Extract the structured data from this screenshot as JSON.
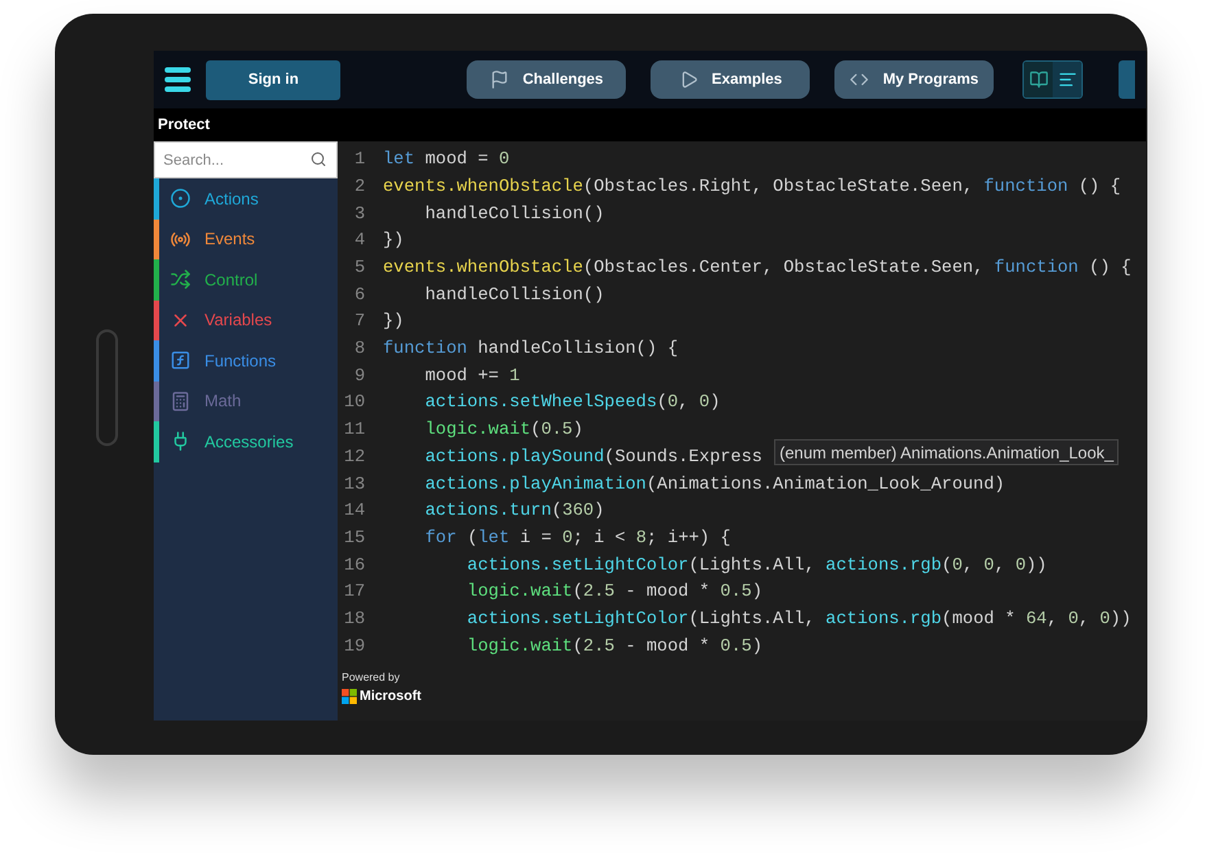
{
  "topbar": {
    "sign_in": "Sign in",
    "tabs": [
      {
        "label": "Challenges"
      },
      {
        "label": "Examples"
      },
      {
        "label": "My Programs"
      }
    ],
    "view_toggle": [
      {
        "selected": true
      },
      {
        "selected": false
      }
    ]
  },
  "project_name": "Protect",
  "toolbox": {
    "search": {
      "placeholder": "Search..."
    },
    "categories": [
      {
        "label": "Actions",
        "color": "#1fa8d8"
      },
      {
        "label": "Events",
        "color": "#f0883a"
      },
      {
        "label": "Control",
        "color": "#22b04b"
      },
      {
        "label": "Variables",
        "color": "#e5484d"
      },
      {
        "label": "Functions",
        "color": "#3a8ee6"
      },
      {
        "label": "Math",
        "color": "#6b6a99"
      },
      {
        "label": "Accessories",
        "color": "#22c9a0"
      }
    ]
  },
  "editor": {
    "lines": [
      {
        "number": "1",
        "tokens": [
          {
            "kind": "keyword",
            "text": "let"
          },
          {
            "kind": "plain",
            "text": " mood = "
          },
          {
            "kind": "number",
            "text": "0"
          }
        ]
      },
      {
        "number": "2",
        "tokens": [
          {
            "kind": "event",
            "text": "events.whenObstacle"
          },
          {
            "kind": "plain",
            "text": "(Obstacles.Right, ObstacleState.Seen, "
          },
          {
            "kind": "keyword",
            "text": "function"
          },
          {
            "kind": "plain",
            "text": " () {"
          }
        ]
      },
      {
        "number": "3",
        "tokens": [
          {
            "kind": "plain",
            "text": "    handleCollision()"
          }
        ]
      },
      {
        "number": "4",
        "tokens": [
          {
            "kind": "plain",
            "text": "})"
          }
        ]
      },
      {
        "number": "5",
        "tokens": [
          {
            "kind": "event",
            "text": "events.whenObstacle"
          },
          {
            "kind": "plain",
            "text": "(Obstacles.Center, ObstacleState.Seen, "
          },
          {
            "kind": "keyword",
            "text": "function"
          },
          {
            "kind": "plain",
            "text": " () {"
          }
        ]
      },
      {
        "number": "6",
        "tokens": [
          {
            "kind": "plain",
            "text": "    handleCollision()"
          }
        ]
      },
      {
        "number": "7",
        "tokens": [
          {
            "kind": "plain",
            "text": "})"
          }
        ]
      },
      {
        "number": "8",
        "tokens": [
          {
            "kind": "keyword",
            "text": "function"
          },
          {
            "kind": "plain",
            "text": " handleCollision() {"
          }
        ]
      },
      {
        "number": "9",
        "tokens": [
          {
            "kind": "plain",
            "text": "    mood += "
          },
          {
            "kind": "number",
            "text": "1"
          }
        ]
      },
      {
        "number": "10",
        "tokens": [
          {
            "kind": "action",
            "text": "    actions.setWheelSpeeds"
          },
          {
            "kind": "plain",
            "text": "("
          },
          {
            "kind": "number",
            "text": "0"
          },
          {
            "kind": "plain",
            "text": ", "
          },
          {
            "kind": "number",
            "text": "0"
          },
          {
            "kind": "plain",
            "text": ")"
          }
        ]
      },
      {
        "number": "11",
        "tokens": [
          {
            "kind": "logic",
            "text": "    logic.wait"
          },
          {
            "kind": "plain",
            "text": "("
          },
          {
            "kind": "number",
            "text": "0.5"
          },
          {
            "kind": "plain",
            "text": ")"
          }
        ]
      },
      {
        "number": "12",
        "tokens": [
          {
            "kind": "action",
            "text": "    actions.playSound"
          },
          {
            "kind": "plain",
            "text": "(Sounds.Express"
          }
        ]
      },
      {
        "number": "13",
        "tokens": [
          {
            "kind": "action",
            "text": "    actions.playAnimation"
          },
          {
            "kind": "plain",
            "text": "(Animations.Animation_Look_Around)"
          }
        ]
      },
      {
        "number": "14",
        "tokens": [
          {
            "kind": "action",
            "text": "    actions.turn"
          },
          {
            "kind": "plain",
            "text": "("
          },
          {
            "kind": "number",
            "text": "360"
          },
          {
            "kind": "plain",
            "text": ")"
          }
        ]
      },
      {
        "number": "15",
        "tokens": [
          {
            "kind": "keyword",
            "text": "    for"
          },
          {
            "kind": "plain",
            "text": " ("
          },
          {
            "kind": "keyword",
            "text": "let"
          },
          {
            "kind": "plain",
            "text": " i = "
          },
          {
            "kind": "number",
            "text": "0"
          },
          {
            "kind": "plain",
            "text": "; i < "
          },
          {
            "kind": "number",
            "text": "8"
          },
          {
            "kind": "plain",
            "text": "; i++) {"
          }
        ]
      },
      {
        "number": "16",
        "tokens": [
          {
            "kind": "action",
            "text": "        actions.setLightColor"
          },
          {
            "kind": "plain",
            "text": "(Lights.All, "
          },
          {
            "kind": "action",
            "text": "actions.rgb"
          },
          {
            "kind": "plain",
            "text": "("
          },
          {
            "kind": "number",
            "text": "0"
          },
          {
            "kind": "plain",
            "text": ", "
          },
          {
            "kind": "number",
            "text": "0"
          },
          {
            "kind": "plain",
            "text": ", "
          },
          {
            "kind": "number",
            "text": "0"
          },
          {
            "kind": "plain",
            "text": "))"
          }
        ]
      },
      {
        "number": "17",
        "tokens": [
          {
            "kind": "logic",
            "text": "        logic.wait"
          },
          {
            "kind": "plain",
            "text": "("
          },
          {
            "kind": "number",
            "text": "2.5"
          },
          {
            "kind": "plain",
            "text": " - mood * "
          },
          {
            "kind": "number",
            "text": "0.5"
          },
          {
            "kind": "plain",
            "text": ")"
          }
        ]
      },
      {
        "number": "18",
        "tokens": [
          {
            "kind": "action",
            "text": "        actions.setLightColor"
          },
          {
            "kind": "plain",
            "text": "(Lights.All, "
          },
          {
            "kind": "action",
            "text": "actions.rgb"
          },
          {
            "kind": "plain",
            "text": "(mood * "
          },
          {
            "kind": "number",
            "text": "64"
          },
          {
            "kind": "plain",
            "text": ", "
          },
          {
            "kind": "number",
            "text": "0"
          },
          {
            "kind": "plain",
            "text": ", "
          },
          {
            "kind": "number",
            "text": "0"
          },
          {
            "kind": "plain",
            "text": "))"
          }
        ]
      },
      {
        "number": "19",
        "tokens": [
          {
            "kind": "logic",
            "text": "        logic.wait"
          },
          {
            "kind": "plain",
            "text": "("
          },
          {
            "kind": "number",
            "text": "2.5"
          },
          {
            "kind": "plain",
            "text": " - mood * "
          },
          {
            "kind": "number",
            "text": "0.5"
          },
          {
            "kind": "plain",
            "text": ")"
          }
        ]
      }
    ],
    "tooltip": "(enum member) Animations.Animation_Look_",
    "powered_by": "Powered by",
    "brand": "Microsoft"
  }
}
